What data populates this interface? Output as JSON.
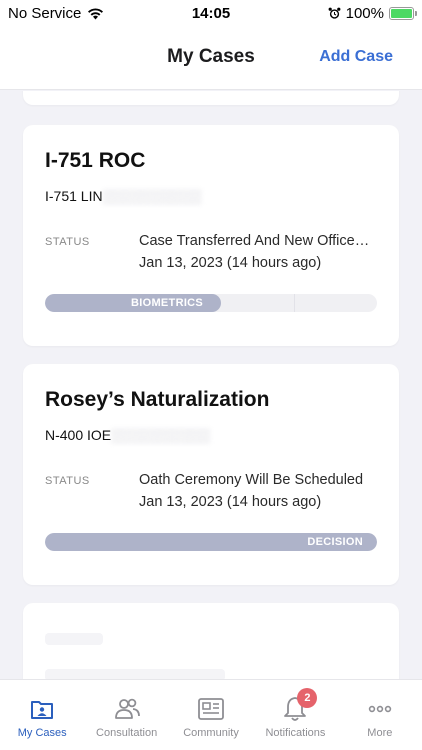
{
  "status_bar": {
    "carrier": "No Service",
    "time": "14:05",
    "battery_percent": "100%",
    "battery_level": 1.0
  },
  "header": {
    "title": "My Cases",
    "action": "Add Case"
  },
  "cases": [
    {
      "title": "I-751 ROC",
      "form_code": "I-751 LIN",
      "status_label": "STATUS",
      "status_text": "Case Transferred And New Office…",
      "status_date": "Jan 13, 2023 (14 hours ago)",
      "progress_label": "BIOMETRICS",
      "progress_fraction": 0.53
    },
    {
      "title": "Rosey’s Naturalization",
      "form_code": "N-400 IOE",
      "status_label": "STATUS",
      "status_text": "Oath Ceremony Will Be Scheduled",
      "status_date": "Jan 13, 2023 (14 hours ago)",
      "progress_label": "DECISION",
      "progress_fraction": 1.0
    }
  ],
  "tabs": [
    {
      "label": "My Cases",
      "icon": "briefcase-icon",
      "active": true
    },
    {
      "label": "Consultation",
      "icon": "people-icon"
    },
    {
      "label": "Community",
      "icon": "newspaper-icon"
    },
    {
      "label": "Notifications",
      "icon": "bell-icon",
      "badge": "2"
    },
    {
      "label": "More",
      "icon": "more-dots-icon"
    }
  ],
  "colors": {
    "accent": "#3b6fd4",
    "progress": "#aeb3c9",
    "badge": "#e5636b",
    "battery": "#4cd964"
  }
}
